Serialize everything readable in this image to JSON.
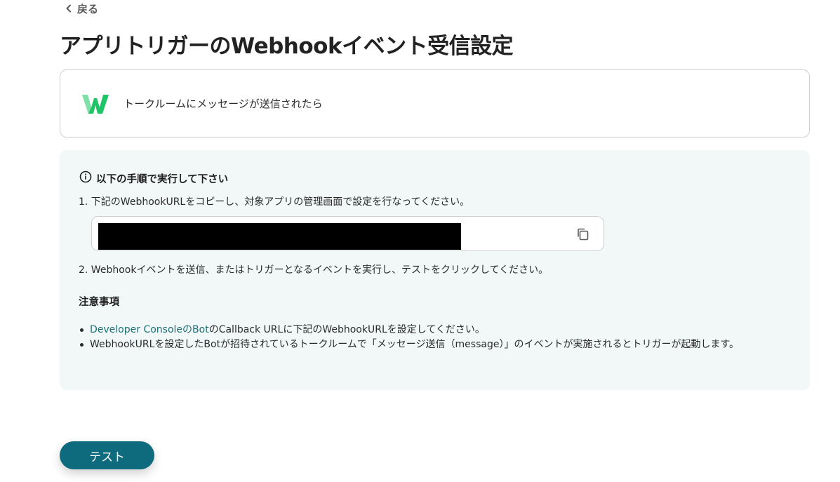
{
  "nav": {
    "back_label": "戻る"
  },
  "page": {
    "title": "アプリトリガーのWebhookイベント受信設定"
  },
  "trigger": {
    "app_icon": "lineworks-w-logo",
    "label": "トークルームにメッセージが送信されたら"
  },
  "instructions": {
    "header": "以下の手順で実行して下さい",
    "step1": "1. 下記のWebhookURLをコピーし、対象アプリの管理画面で設定を行なってください。",
    "webhook_url": "",
    "step2": "2. Webhookイベントを送信、またはトリガーとなるイベントを実行し、テストをクリックしてください。",
    "notes_title": "注意事項",
    "note1_link": "Developer ConsoleのBot",
    "note1_text": "のCallback URLに下記のWebhookURLを設定してください。",
    "note2": "WebhookURLを設定したBotが招待されているトークルームで「メッセージ送信（message）」のイベントが実施されるとトリガーが起動します。"
  },
  "actions": {
    "test_label": "テスト"
  },
  "colors": {
    "primary": "#0e6a7d",
    "link": "#1d6f76",
    "panel_bg": "#f1f8f7",
    "logo_green": "#1fc466"
  }
}
